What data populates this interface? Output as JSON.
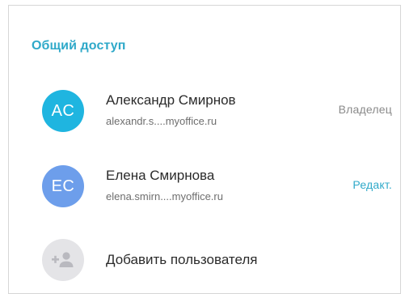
{
  "section": {
    "title": "Общий доступ"
  },
  "users": [
    {
      "initials": "AC",
      "name": "Александр Смирнов",
      "email": "alexandr.s....myoffice.ru",
      "role": "Владелец",
      "avatar_color": "#1fb5e0"
    },
    {
      "initials": "EC",
      "name": "Елена Смирнова",
      "email": "elena.smirn....myoffice.ru",
      "role": "Редакт.",
      "avatar_color": "#6d9eeb"
    }
  ],
  "add_user": {
    "label": "Добавить пользователя",
    "icon": "add-person-icon"
  },
  "colors": {
    "accent": "#2fa9c9",
    "owner_role": "#8a8a8a",
    "add_avatar_bg": "#e4e4e7",
    "add_icon": "#b9b9bf"
  }
}
